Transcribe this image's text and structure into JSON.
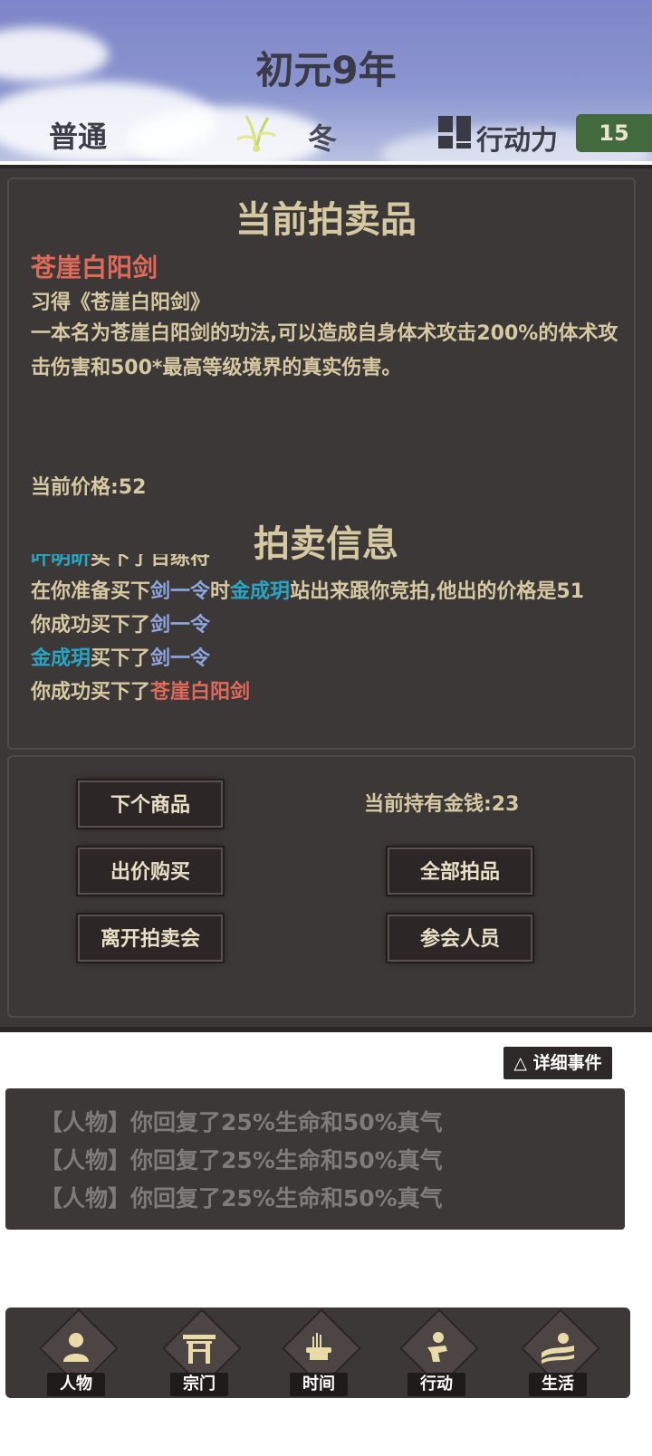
{
  "header": {
    "year": "初元9年",
    "mode": "普通",
    "season": "冬",
    "action_label": "行动力",
    "action_value": "15"
  },
  "auction": {
    "section_title": "当前拍卖品",
    "item_name": "苍崖白阳剑",
    "item_learn": "习得《苍崖白阳剑》",
    "item_desc": "一本名为苍崖白阳剑的功法,可以造成自身体术攻击200%的体术攻击伤害和500*最高等级境界的真实伤害。",
    "price": "当前价格:52",
    "info_title": "拍卖信息",
    "log": [
      {
        "parts": [
          {
            "t": "叶明昕",
            "c": "cyan"
          },
          {
            "t": "买下了"
          },
          {
            "t": "百练符"
          }
        ]
      },
      {
        "parts": [
          {
            "t": "在你准备买下"
          },
          {
            "t": "剑一令",
            "c": "blue"
          },
          {
            "t": "时"
          },
          {
            "t": "金成玥",
            "c": "cyan"
          },
          {
            "t": "站出来跟你竞拍,他出的价格是51"
          }
        ]
      },
      {
        "parts": [
          {
            "t": "你成功买下了"
          },
          {
            "t": "剑一令",
            "c": "blue"
          }
        ]
      },
      {
        "parts": [
          {
            "t": "金成玥",
            "c": "cyan"
          },
          {
            "t": "买下了"
          },
          {
            "t": "剑一令",
            "c": "blue"
          }
        ]
      },
      {
        "parts": [
          {
            "t": "你成功买下了"
          },
          {
            "t": "苍崖白阳剑",
            "c": "red"
          }
        ]
      }
    ]
  },
  "controls": {
    "next_item": "下个商品",
    "bid_buy": "出价购买",
    "leave": "离开拍卖会",
    "money": "当前持有金钱:23",
    "all_items": "全部拍品",
    "attendees": "参会人员"
  },
  "events": {
    "detail_button": "△ 详细事件",
    "items": [
      "【人物】你回复了25%生命和50%真气",
      "【人物】你回复了25%生命和50%真气",
      "【人物】你回复了25%生命和50%真气"
    ]
  },
  "nav": {
    "items": [
      {
        "label": "人物",
        "icon": "person-icon"
      },
      {
        "label": "宗门",
        "icon": "sect-gate-icon"
      },
      {
        "label": "时间",
        "icon": "incense-icon"
      },
      {
        "label": "行动",
        "icon": "action-icon"
      },
      {
        "label": "生活",
        "icon": "life-landscape-icon"
      }
    ]
  },
  "colors": {
    "panel_bg": "#3d3838",
    "gold_text": "#d6c9a2",
    "name_cyan": "#27a6c4",
    "item_blue": "#8ea6e0",
    "item_red": "#e06a5a",
    "action_green": "#436a3e"
  }
}
